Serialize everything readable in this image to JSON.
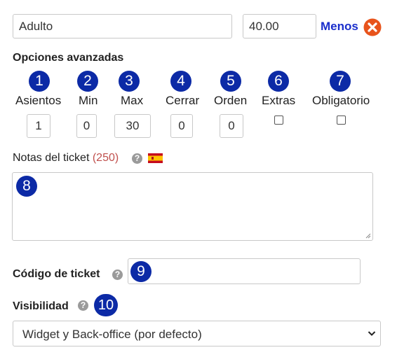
{
  "price_row": {
    "name_value": "Adulto",
    "price_value": "40.00",
    "remove_label": "Menos"
  },
  "advanced": {
    "title": "Opciones avanzadas",
    "columns": [
      {
        "num": "1",
        "label": "Asientos",
        "value": "1"
      },
      {
        "num": "2",
        "label": "Min",
        "value": "0"
      },
      {
        "num": "3",
        "label": "Max",
        "value": "30"
      },
      {
        "num": "4",
        "label": "Cerrar",
        "value": "0"
      },
      {
        "num": "5",
        "label": "Orden",
        "value": "0"
      },
      {
        "num": "6",
        "label": "Extras"
      },
      {
        "num": "7",
        "label": "Obligatorio"
      }
    ]
  },
  "notes": {
    "label": "Notas del ticket",
    "count": "(250)",
    "help_glyph": "?",
    "badge": "8"
  },
  "ticket_code": {
    "label": "Código de ticket",
    "help_glyph": "?",
    "badge": "9",
    "value": ""
  },
  "visibility": {
    "label": "Visibilidad",
    "help_glyph": "?",
    "badge": "10",
    "selected": "Widget y Back-office (por defecto)"
  },
  "colors": {
    "badge_blue": "#0c2aa6",
    "link_blue": "#1a2ecc",
    "remove_orange": "#e8541c",
    "count_red": "#c0504d"
  }
}
